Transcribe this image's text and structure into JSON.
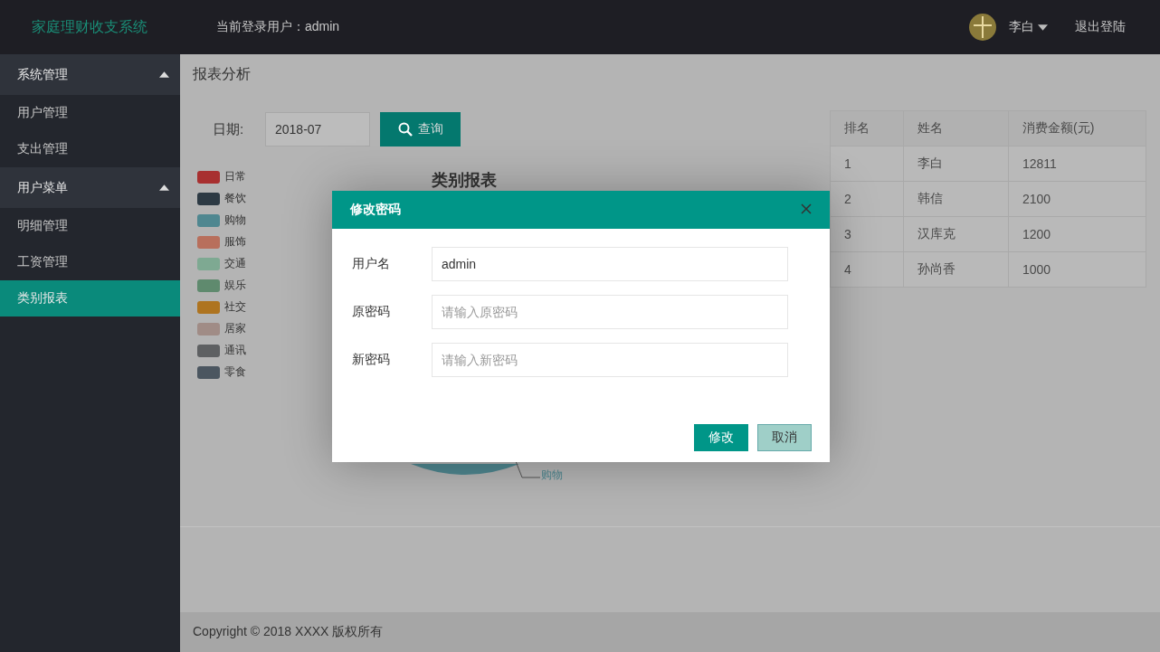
{
  "header": {
    "app_title": "家庭理财收支系统",
    "current_user": "当前登录用户：admin",
    "user_name": "李白",
    "logout": "退出登陆"
  },
  "sidebar": {
    "groups": [
      {
        "label": "系统管理",
        "expanded": true,
        "items": [
          {
            "label": "用户管理",
            "selected": false
          },
          {
            "label": "支出管理",
            "selected": false
          }
        ]
      },
      {
        "label": "用户菜单",
        "expanded": true,
        "items": [
          {
            "label": "明细管理",
            "selected": false
          },
          {
            "label": "工资管理",
            "selected": false
          },
          {
            "label": "类别报表",
            "selected": true
          }
        ]
      }
    ]
  },
  "breadcrumb": "报表分析",
  "query": {
    "label": "日期:",
    "value": "2018-07",
    "button": "查询"
  },
  "chart": {
    "title": "类别报表",
    "slice_label": "购物",
    "legend": [
      {
        "label": "日常",
        "color": "#a83030"
      },
      {
        "label": "餐饮",
        "color": "#2d3a44"
      },
      {
        "label": "购物",
        "color": "#4f8790"
      },
      {
        "label": "服饰",
        "color": "#b86f5c"
      },
      {
        "label": "交通",
        "color": "#7ea992"
      },
      {
        "label": "娱乐",
        "color": "#5f8a6e"
      },
      {
        "label": "社交",
        "color": "#ae7420"
      },
      {
        "label": "居家",
        "color": "#a08c86"
      },
      {
        "label": "通讯",
        "color": "#5e6062"
      },
      {
        "label": "零食",
        "color": "#4b5660"
      }
    ]
  },
  "ranking": {
    "columns": [
      "排名",
      "姓名",
      "消费金额(元)"
    ],
    "rows": [
      [
        "1",
        "李白",
        "12811"
      ],
      [
        "2",
        "韩信",
        "2100"
      ],
      [
        "3",
        "汉库克",
        "1200"
      ],
      [
        "4",
        "孙尚香",
        "1000"
      ]
    ]
  },
  "footer": "Copyright © 2018 XXXX 版权所有",
  "dialog": {
    "title": "修改密码",
    "fields": [
      {
        "label": "用户名",
        "value": "admin"
      },
      {
        "label": "原密码",
        "placeholder": "请输入原密码"
      },
      {
        "label": "新密码",
        "placeholder": "请输入新密码"
      }
    ],
    "buttons": [
      {
        "label": "修改",
        "kind": "primary"
      },
      {
        "label": "取消",
        "kind": "secondary"
      }
    ]
  }
}
